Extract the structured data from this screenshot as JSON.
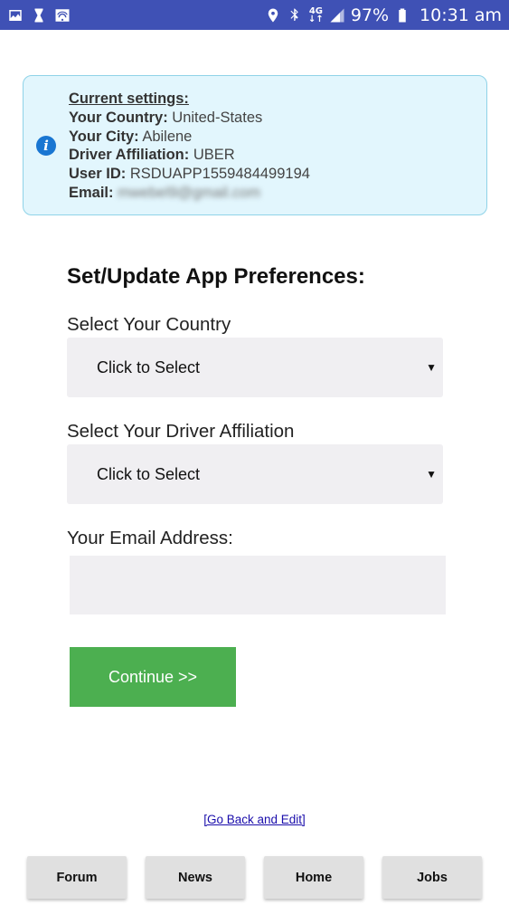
{
  "status_bar": {
    "left_icons": [
      "image-icon",
      "hourglass-icon",
      "wifi-icon"
    ],
    "right_icons": [
      "location-icon",
      "bluetooth-icon",
      "network-4g-icon",
      "signal-icon",
      "battery-icon"
    ],
    "network_label_top": "4G",
    "network_label_bottom": "↓↑",
    "battery_percent": "97%",
    "time": "10:31 am"
  },
  "current_settings": {
    "heading": "Current settings:",
    "country_label": "Your Country:",
    "country_value": "United-States",
    "city_label": "Your City:",
    "city_value": "Abilene",
    "affiliation_label": "Driver Affiliation:",
    "affiliation_value": "UBER",
    "user_id_label": "User ID:",
    "user_id_value": "RSDUAPP1559484499194",
    "email_label": "Email:",
    "email_value": "mwebel9@gmail.com"
  },
  "form": {
    "title": "Set/Update App Preferences:",
    "country_label": "Select Your Country",
    "country_select": "Click to Select",
    "affiliation_label": "Select Your Driver Affiliation",
    "affiliation_select": "Click to Select",
    "email_label": "Your Email Address:",
    "email_value": "",
    "continue_label": "Continue >>"
  },
  "back_link": "[Go Back and Edit]",
  "bottom_nav": {
    "forum": "Forum",
    "news": "News",
    "home": "Home",
    "jobs": "Jobs"
  },
  "colors": {
    "status_bar": "#3f51b5",
    "info_bg": "#e2f6fd",
    "info_border": "#8fd3e8",
    "continue_button": "#4caf50",
    "field_bg": "#f0eff2"
  }
}
